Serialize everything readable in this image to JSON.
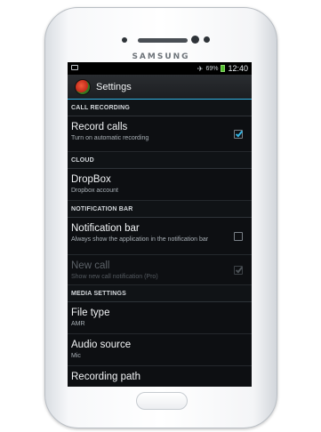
{
  "device": {
    "brand": "SAMSUNG"
  },
  "status_bar": {
    "battery_percent": "69%",
    "time": "12:40"
  },
  "action_bar": {
    "title": "Settings"
  },
  "settings": {
    "call_recording_header": "CALL RECORDING",
    "record_calls": {
      "title": "Record calls",
      "summary": "Turn on automatic recording",
      "checked": true
    },
    "cloud_header": "CLOUD",
    "dropbox": {
      "title": "DropBox",
      "summary": "Dropbox account"
    },
    "notification_header": "NOTIFICATION BAR",
    "notification_bar": {
      "title": "Notification bar",
      "summary": "Always show the application in the notification bar",
      "checked": false
    },
    "new_call": {
      "title": "New call",
      "summary": "Show new call notification (Pro)",
      "checked": true,
      "enabled": false
    },
    "media_header": "MEDIA SETTINGS",
    "file_type": {
      "title": "File type",
      "summary": "AMR"
    },
    "audio_source": {
      "title": "Audio source",
      "summary": "Mic"
    },
    "recording_path": {
      "title": "Recording path"
    }
  },
  "colors": {
    "accent": "#33b5e5",
    "background": "#0d0f12"
  }
}
